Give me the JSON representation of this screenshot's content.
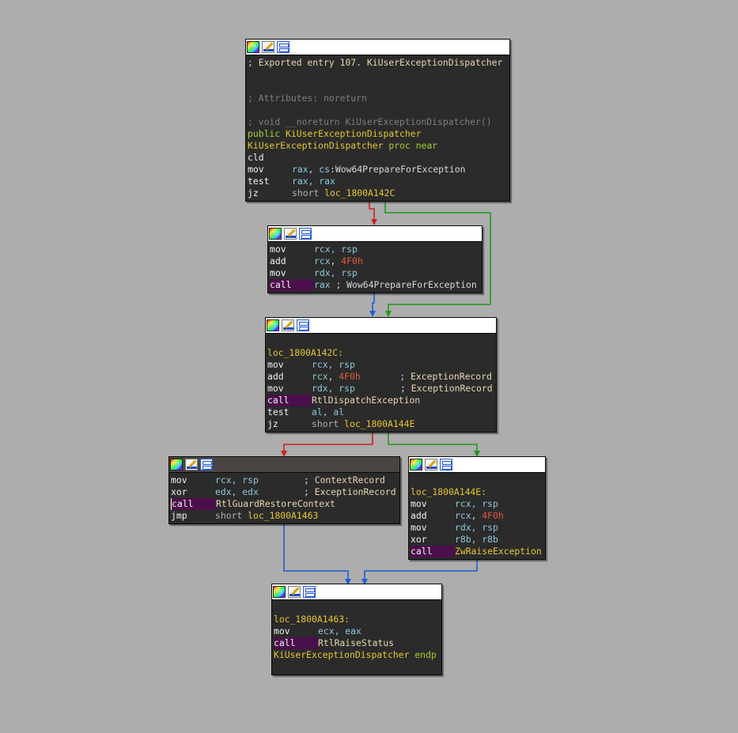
{
  "graph": {
    "colors": {
      "background": "#adadad",
      "node_bg": "#2b2b2b",
      "edge_true": "#1f9a1f",
      "edge_false": "#cc2222",
      "edge_jump": "#1e5fd6"
    },
    "header_icons": [
      "color-palette-icon",
      "rename-pencil-icon",
      "graph-view-icon"
    ],
    "blocks": {
      "b1": {
        "lines": {
          "exported": "; Exported entry 107. KiUserExceptionDispatcher",
          "attributes": "; Attributes: noreturn",
          "proto": "; void __noreturn KiUserExceptionDispatcher()",
          "public_kw": "public",
          "public_name": "KiUserExceptionDispatcher",
          "proc_name": "KiUserExceptionDispatcher",
          "proc_kw": "proc near",
          "i1_mn": "cld",
          "i2_mn": "mov",
          "i2_reg": "rax",
          "i2_seg": "cs",
          "i2_sym": "Wow64PrepareForException",
          "i3_mn": "test",
          "i3_ops": "rax, rax",
          "i4_mn": "jz",
          "i4_short": "short",
          "i4_lbl": "loc_1800A142C"
        }
      },
      "b2": {
        "lines": {
          "i1_mn": "mov",
          "i1_ops": "rcx, rsp",
          "i2_mn": "add",
          "i2_reg": "rcx",
          "i2_num": "4F0h",
          "i3_mn": "mov",
          "i3_ops": "rdx, rsp",
          "i4_mn": "call",
          "i4_reg": "rax",
          "i4_cmt": "; Wow64PrepareForException"
        }
      },
      "b3": {
        "lines": {
          "label": "loc_1800A142C:",
          "i1_mn": "mov",
          "i1_ops": "rcx, rsp",
          "i2_mn": "add",
          "i2_reg": "rcx",
          "i2_num": "4F0h",
          "i2_cmt": "ExceptionRecord",
          "i3_mn": "mov",
          "i3_ops": "rdx, rsp",
          "i3_cmt": "ExceptionRecord",
          "i4_mn": "call",
          "i4_sym": "RtlDispatchException",
          "i5_mn": "test",
          "i5_ops": "al, al",
          "i6_mn": "jz",
          "i6_short": "short",
          "i6_lbl": "loc_1800A144E"
        }
      },
      "b4": {
        "lines": {
          "i1_mn": "mov",
          "i1_ops": "rcx, rsp",
          "i1_cmt": "ContextRecord",
          "i2_mn": "xor",
          "i2_ops": "edx, edx",
          "i2_cmt": "ExceptionRecord",
          "i3_mn": "call",
          "i3_sym": "RtlGuardRestoreContext",
          "i4_mn": "jmp",
          "i4_short": "short",
          "i4_lbl": "loc_1800A1463"
        }
      },
      "b5": {
        "lines": {
          "label": "loc_1800A144E:",
          "i1_mn": "mov",
          "i1_ops": "rcx, rsp",
          "i2_mn": "add",
          "i2_reg": "rcx",
          "i2_num": "4F0h",
          "i3_mn": "mov",
          "i3_ops": "rdx, rsp",
          "i4_mn": "xor",
          "i4_ops": "r8b, r8b",
          "i5_mn": "call",
          "i5_sym": "ZwRaiseException"
        }
      },
      "b6": {
        "lines": {
          "label": "loc_1800A1463:",
          "i1_mn": "mov",
          "i1_ops": "ecx, eax",
          "i2_mn": "call",
          "i2_sym": "RtlRaiseStatus",
          "endp_name": "KiUserExceptionDispatcher",
          "endp_kw": "endp"
        }
      }
    }
  }
}
